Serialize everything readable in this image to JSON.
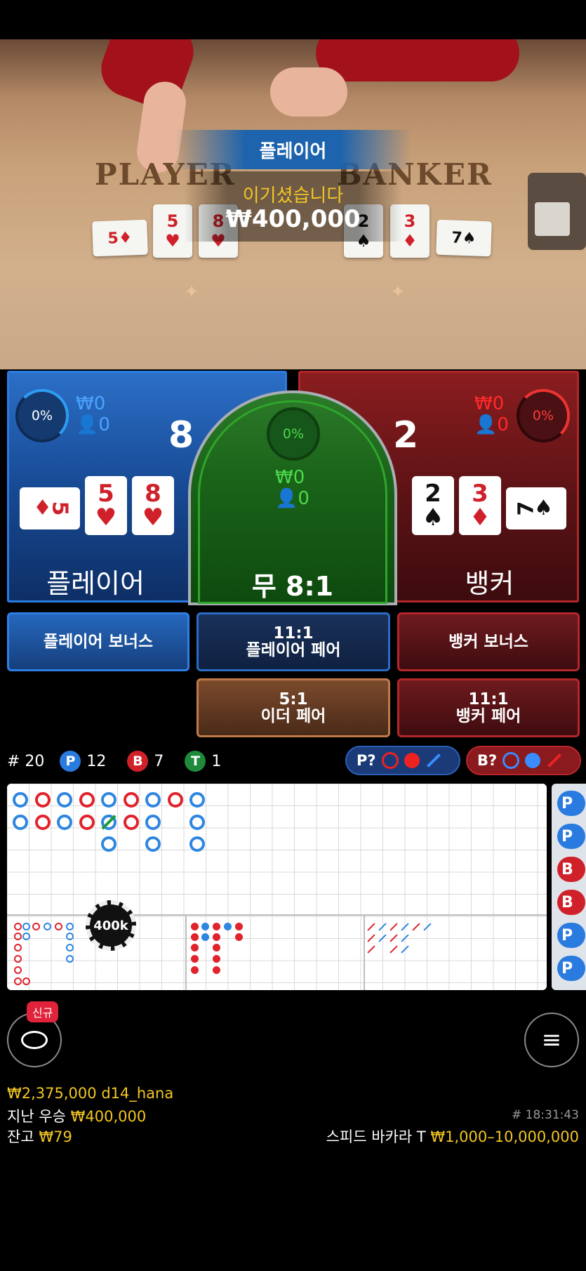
{
  "video": {
    "felt_player": "PLAYER",
    "felt_banker": "BANKER",
    "win_banner": "플레이어",
    "win_message": "이기셨습니다",
    "win_amount": "₩400,000",
    "player_cards": [
      {
        "rank": "5",
        "suit": "♦",
        "color": "red"
      },
      {
        "rank": "5",
        "suit": "♥",
        "color": "red"
      },
      {
        "rank": "8",
        "suit": "♥",
        "color": "red"
      }
    ],
    "banker_cards": [
      {
        "rank": "2",
        "suit": "♠",
        "color": "black"
      },
      {
        "rank": "3",
        "suit": "♦",
        "color": "red"
      },
      {
        "rank": "7",
        "suit": "♠",
        "color": "black"
      }
    ]
  },
  "player_panel": {
    "percent": "0%",
    "bet_amount": "₩0",
    "bettors": "0",
    "score": "8",
    "label": "플레이어",
    "cards": [
      {
        "rank": "5",
        "suit": "♦",
        "color": "red",
        "sideways": true
      },
      {
        "rank": "5",
        "suit": "♥",
        "color": "red",
        "sideways": false
      },
      {
        "rank": "8",
        "suit": "♥",
        "color": "red",
        "sideways": false
      }
    ]
  },
  "tie_panel": {
    "percent": "0%",
    "bet_amount": "₩0",
    "bettors": "0",
    "label": "무 8:1"
  },
  "banker_panel": {
    "percent": "0%",
    "bet_amount": "₩0",
    "bettors": "0",
    "score": "2",
    "label": "뱅커",
    "cards": [
      {
        "rank": "2",
        "suit": "♠",
        "color": "black",
        "sideways": false
      },
      {
        "rank": "3",
        "suit": "♦",
        "color": "red",
        "sideways": false
      },
      {
        "rank": "7",
        "suit": "♠",
        "color": "black",
        "sideways": true
      }
    ]
  },
  "side_bets": {
    "player_bonus": "플레이어 보너스",
    "player_pair_odds": "11:1",
    "player_pair": "플레이어 페어",
    "banker_bonus": "뱅커 보너스",
    "either_pair_odds": "5:1",
    "either_pair": "이더 페어",
    "banker_pair_odds": "11:1",
    "banker_pair": "뱅커 페어"
  },
  "stats": {
    "total_label": "# 20",
    "p_letter": "P",
    "p_count": "12",
    "b_letter": "B",
    "b_count": "7",
    "t_letter": "T",
    "t_count": "1",
    "predict_player": "P?",
    "predict_banker": "B?"
  },
  "roadmap": {
    "chip_label": "400k",
    "side_letters": [
      "P",
      "P",
      "B",
      "B",
      "P",
      "P"
    ]
  },
  "bottom": {
    "new_badge": "신규",
    "balance_user": "₩2,375,000 d14_hana",
    "last_win_label": "지난 우승",
    "last_win_amount": "₩400,000",
    "round_id": "# 18:31:43",
    "balance_label": "잔고",
    "balance_amount": "₩79",
    "table_name": "스피드 바카라 T",
    "bet_limits": "₩1,000–10,000,000"
  },
  "colors": {
    "player_blue": "#2a7be0",
    "banker_red": "#b2262a",
    "tie_green": "#2fa52b",
    "accent_yellow": "#f3c623"
  }
}
